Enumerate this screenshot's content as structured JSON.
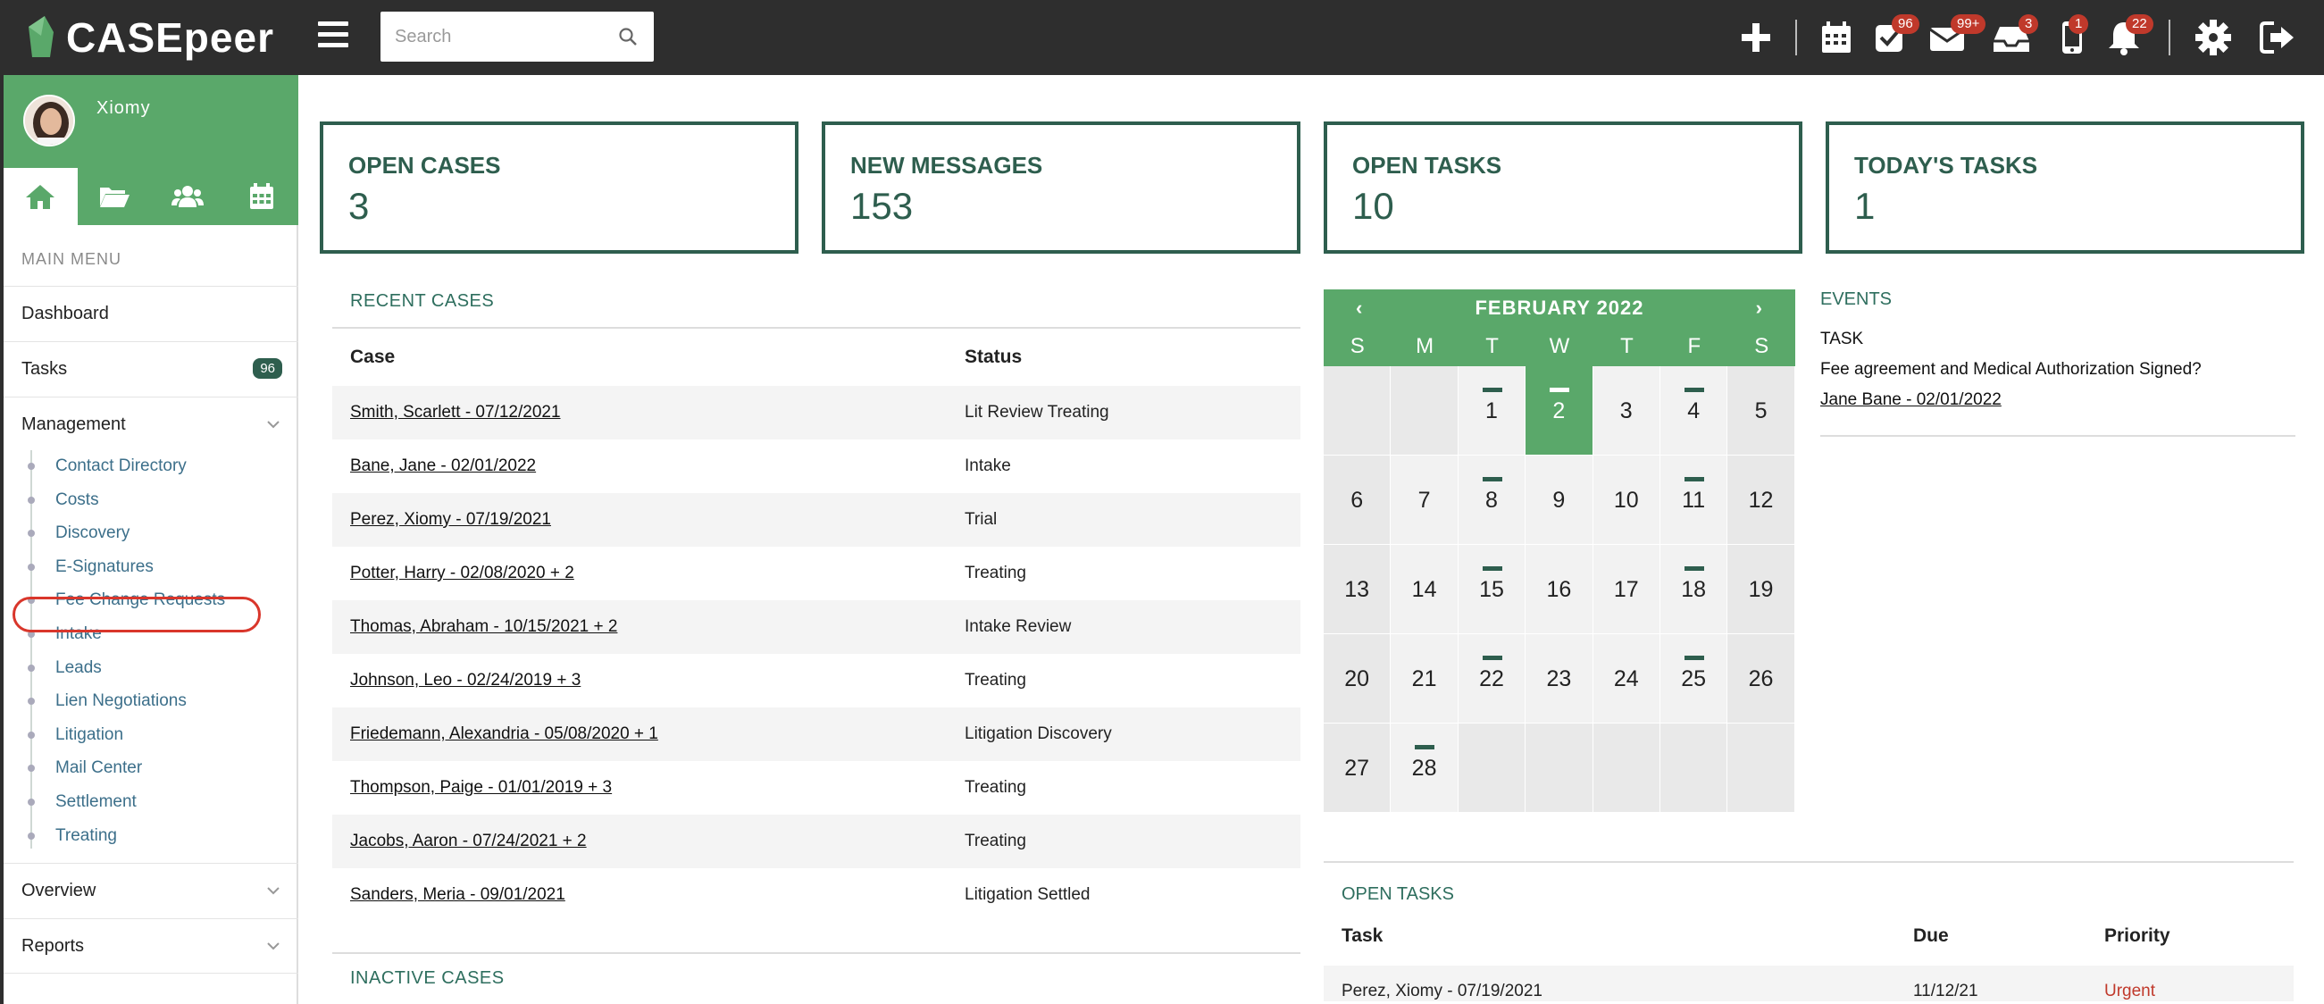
{
  "brand": {
    "name": "CASEpeer"
  },
  "search": {
    "placeholder": "Search"
  },
  "topbar": {
    "badges": {
      "tasks": "96",
      "messages": "99+",
      "inbox": "3",
      "phone": "1",
      "notifications": "22"
    }
  },
  "colors": {
    "accent": "#5aa86a",
    "dark_green": "#2e5e4e",
    "topbar": "#2e2e2e",
    "urgent": "#c0392b"
  },
  "sidebar": {
    "user": "Xiomy",
    "menu_heading": "MAIN MENU",
    "items": [
      {
        "label": "Dashboard"
      },
      {
        "label": "Tasks",
        "count": "96"
      },
      {
        "label": "Management"
      },
      {
        "label": "Overview"
      },
      {
        "label": "Reports"
      }
    ],
    "management_sub": [
      "Contact Directory",
      "Costs",
      "Discovery",
      "E-Signatures",
      "Fee Change Requests",
      "Intake",
      "Leads",
      "Lien Negotiations",
      "Litigation",
      "Mail Center",
      "Settlement",
      "Treating"
    ]
  },
  "stats": [
    {
      "title": "OPEN CASES",
      "value": "3"
    },
    {
      "title": "NEW MESSAGES",
      "value": "153"
    },
    {
      "title": "OPEN TASKS",
      "value": "10"
    },
    {
      "title": "TODAY'S TASKS",
      "value": "1"
    }
  ],
  "recent_cases": {
    "title": "RECENT CASES",
    "col_case": "Case",
    "col_status": "Status",
    "rows": [
      {
        "case": "Smith, Scarlett - 07/12/2021",
        "status": "Lit Review Treating"
      },
      {
        "case": "Bane, Jane - 02/01/2022",
        "status": "Intake"
      },
      {
        "case": "Perez, Xiomy - 07/19/2021",
        "status": "Trial"
      },
      {
        "case": "Potter, Harry - 02/08/2020 + 2",
        "status": "Treating"
      },
      {
        "case": "Thomas, Abraham - 10/15/2021 + 2",
        "status": "Intake Review"
      },
      {
        "case": "Johnson, Leo - 02/24/2019 + 3",
        "status": "Treating"
      },
      {
        "case": "Friedemann, Alexandria - 05/08/2020 + 1",
        "status": "Litigation Discovery"
      },
      {
        "case": "Thompson, Paige - 01/01/2019 + 3",
        "status": "Treating"
      },
      {
        "case": "Jacobs, Aaron - 07/24/2021 + 2",
        "status": "Treating"
      },
      {
        "case": "Sanders, Meria - 09/01/2021",
        "status": "Litigation Settled"
      }
    ]
  },
  "inactive_cases": {
    "title": "INACTIVE CASES"
  },
  "calendar": {
    "prev": "‹",
    "next": "›",
    "month": "FEBRUARY 2022",
    "dow": [
      "S",
      "M",
      "T",
      "W",
      "T",
      "F",
      "S"
    ],
    "leading_blanks": 2,
    "days": 28,
    "today": 2,
    "event_days": [
      1,
      2,
      4,
      8,
      11,
      15,
      18,
      22,
      25,
      28
    ]
  },
  "events": {
    "title": "EVENTS",
    "type": "TASK",
    "text": "Fee agreement and Medical Authorization Signed?",
    "link": "Jane Bane - 02/01/2022"
  },
  "open_tasks": {
    "title": "OPEN TASKS",
    "col_task": "Task",
    "col_due": "Due",
    "col_priority": "Priority",
    "rows": [
      {
        "task": "Perez, Xiomy - 07/19/2021",
        "due": "11/12/21",
        "priority": "Urgent"
      }
    ]
  }
}
